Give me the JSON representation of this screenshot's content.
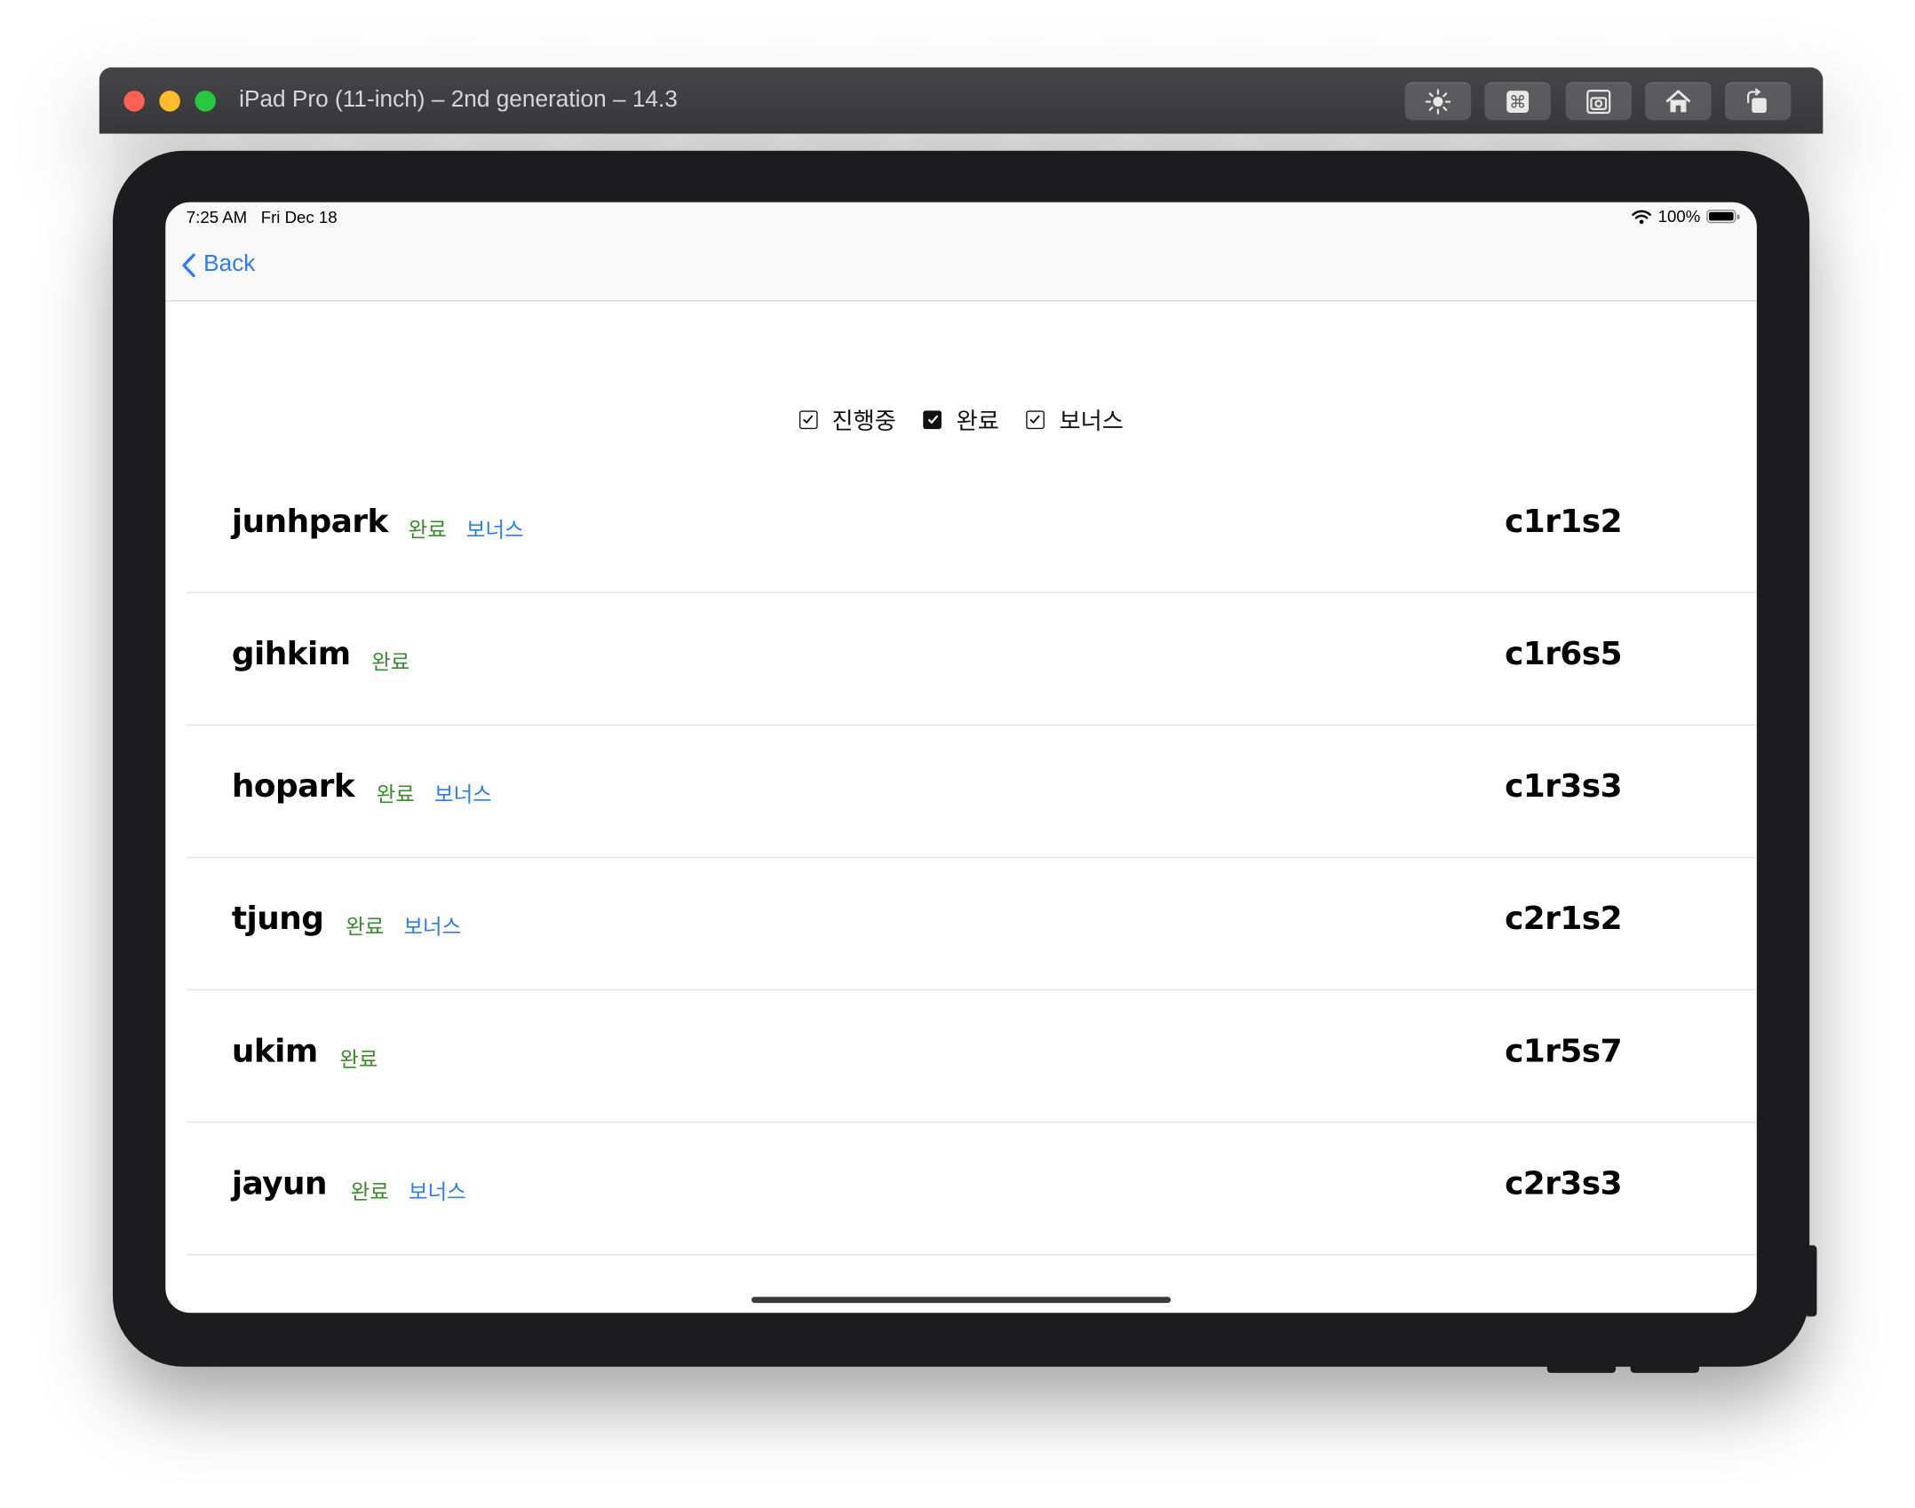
{
  "window": {
    "title": "iPad Pro (11-inch) – 2nd generation – 14.3",
    "toolbar_buttons": [
      {
        "name": "brightness-icon"
      },
      {
        "name": "command-icon"
      },
      {
        "name": "screenshot-icon"
      },
      {
        "name": "home-icon"
      },
      {
        "name": "rotate-icon"
      }
    ]
  },
  "status_bar": {
    "time": "7:25 AM",
    "date": "Fri Dec 18",
    "battery": "100%"
  },
  "nav": {
    "back_label": "Back"
  },
  "filters": [
    {
      "label": "진행중",
      "checked": false
    },
    {
      "label": "완료",
      "checked": true
    },
    {
      "label": "보너스",
      "checked": false
    }
  ],
  "rows": [
    {
      "name": "junhpark",
      "done": "완료",
      "bonus": "보너스",
      "seat": "c1r1s2"
    },
    {
      "name": "gihkim",
      "done": "완료",
      "bonus": "",
      "seat": "c1r6s5"
    },
    {
      "name": "hopark",
      "done": "완료",
      "bonus": "보너스",
      "seat": "c1r3s3"
    },
    {
      "name": "tjung",
      "done": "완료",
      "bonus": "보너스",
      "seat": "c2r1s2"
    },
    {
      "name": "ukim",
      "done": "완료",
      "bonus": "",
      "seat": "c1r5s7"
    },
    {
      "name": "jayun",
      "done": "완료",
      "bonus": "보너스",
      "seat": "c2r3s3"
    }
  ],
  "colors": {
    "accent": "#2c7bf0",
    "done": "#3a8a2e",
    "bezel": "#1c1c1e"
  }
}
